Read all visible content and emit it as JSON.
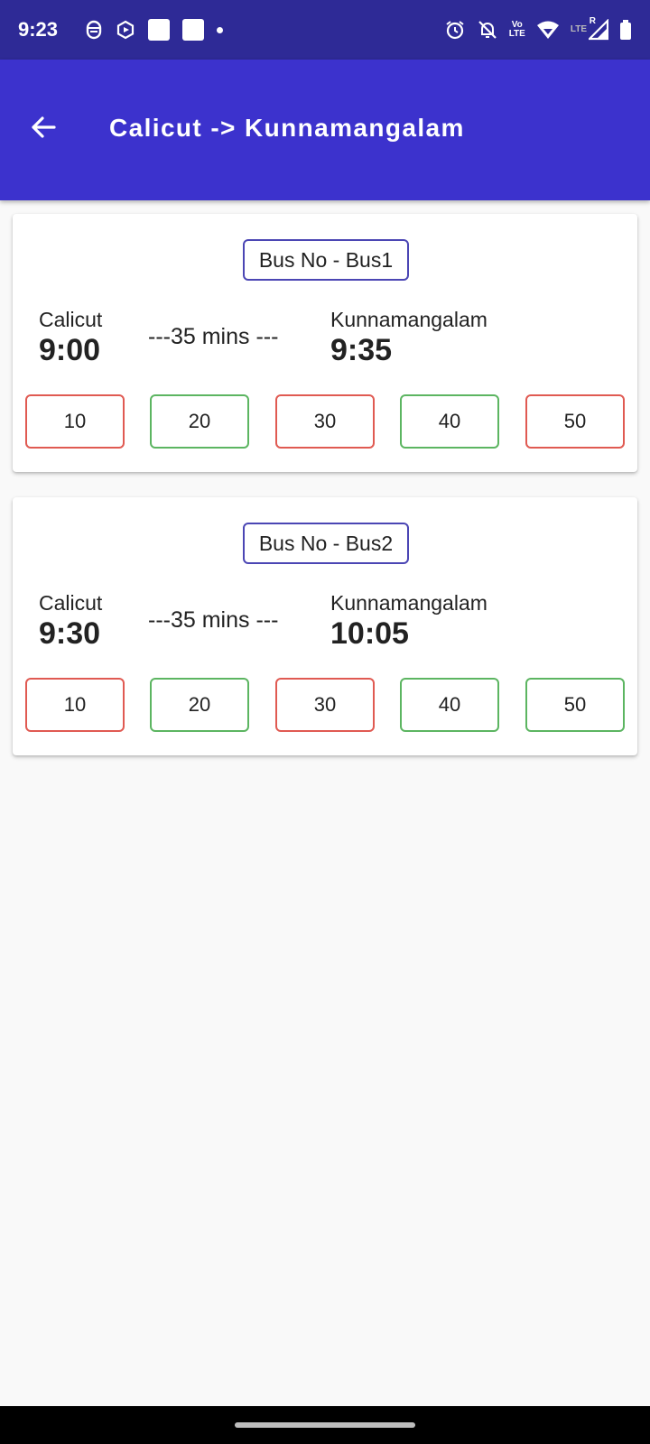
{
  "status_bar": {
    "time": "9:23",
    "network_label_top": "Vo",
    "network_label_bottom": "LTE",
    "signal_label": "LTE",
    "roaming_label": "R",
    "left_icons": [
      "dnd-face-icon",
      "hexagon-icon",
      "square-app-icon",
      "square-app-icon",
      "dot-icon"
    ],
    "right_icons": [
      "alarm-icon",
      "notifications-off-icon",
      "volte-icon",
      "wifi-icon",
      "signal-icon",
      "battery-icon"
    ]
  },
  "app_bar": {
    "title": "Calicut -> Kunnamangalam",
    "back_icon": "arrow-left-icon",
    "color": "#3c32cd"
  },
  "colors": {
    "seat_taken": "#e05a52",
    "seat_free": "#5cb561",
    "bus_badge_border": "#4b46b4"
  },
  "trips": [
    {
      "bus_label": "Bus No - Bus1",
      "origin": "Calicut",
      "departure": "9:00",
      "duration": "---35 mins ---",
      "destination": "Kunnamangalam",
      "arrival": "9:35",
      "seats": [
        {
          "label": "10",
          "status": "taken"
        },
        {
          "label": "20",
          "status": "free"
        },
        {
          "label": "30",
          "status": "taken"
        },
        {
          "label": "40",
          "status": "free"
        },
        {
          "label": "50",
          "status": "taken"
        }
      ]
    },
    {
      "bus_label": "Bus No - Bus2",
      "origin": "Calicut",
      "departure": "9:30",
      "duration": "---35 mins ---",
      "destination": "Kunnamangalam",
      "arrival": "10:05",
      "seats": [
        {
          "label": "10",
          "status": "taken"
        },
        {
          "label": "20",
          "status": "free"
        },
        {
          "label": "30",
          "status": "taken"
        },
        {
          "label": "40",
          "status": "free"
        },
        {
          "label": "50",
          "status": "free"
        }
      ]
    }
  ]
}
